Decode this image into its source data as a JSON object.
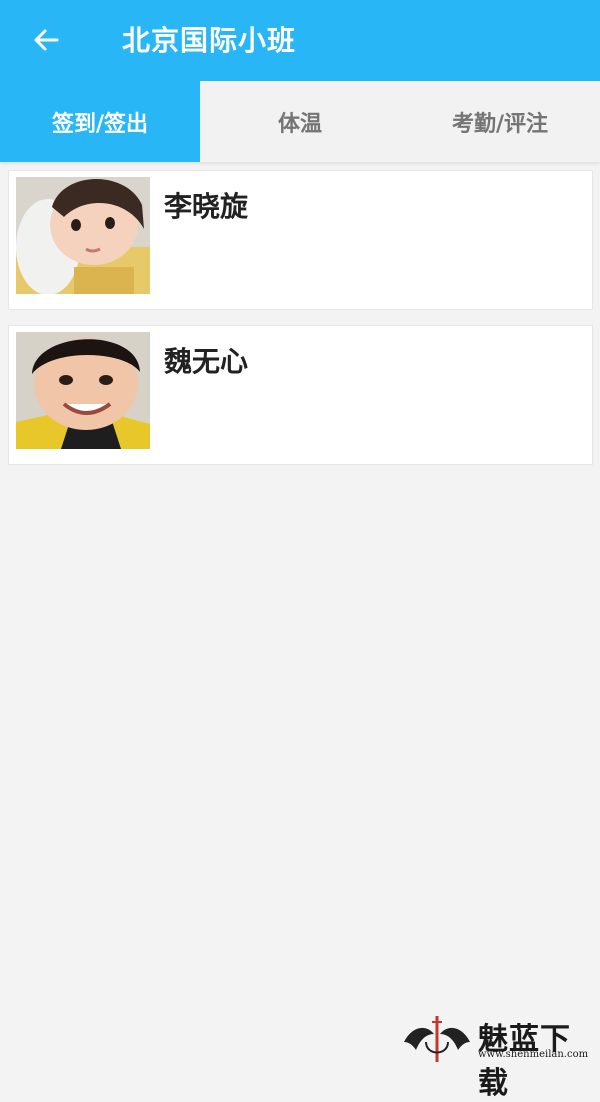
{
  "header": {
    "title": "北京国际小班",
    "back_icon": "arrow-left-icon",
    "background": "#29b6f6"
  },
  "tabs": [
    {
      "label": "签到/签出",
      "active": true
    },
    {
      "label": "体温",
      "active": false
    },
    {
      "label": "考勤/评注",
      "active": false
    }
  ],
  "students": [
    {
      "name": "李晓旋",
      "avatar": "child-photo"
    },
    {
      "name": "魏无心",
      "avatar": "child-photo"
    }
  ],
  "watermark": {
    "logo_text": "魅蓝下载",
    "url": "www.shenmeilan.com"
  }
}
